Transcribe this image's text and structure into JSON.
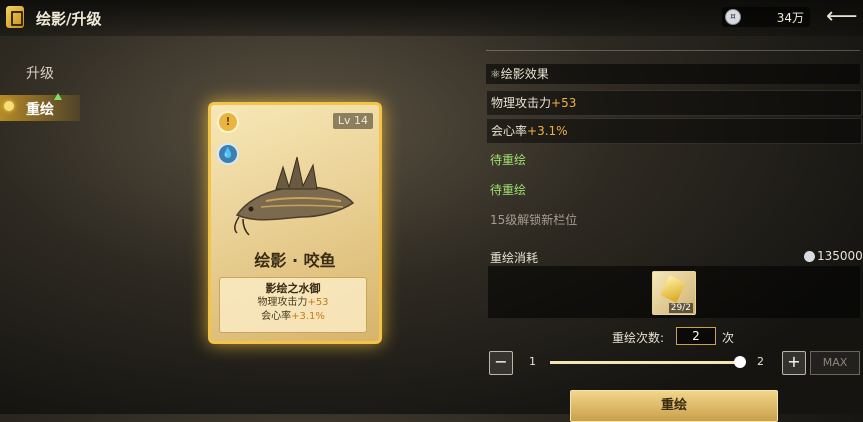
{
  "header": {
    "title": "绘影/升级",
    "currency_value": "34万"
  },
  "sidebar": {
    "items": [
      {
        "label": "升级",
        "selected": false
      },
      {
        "label": "重绘",
        "selected": true
      }
    ]
  },
  "card": {
    "level": "Lv 14",
    "name": "绘影 · 咬鱼",
    "skill_title": "影绘之水御",
    "stat1_name": "物理攻击力",
    "stat1_value": "+53",
    "stat2_name": "会心率",
    "stat2_value": "+3.1%"
  },
  "effects": {
    "header": "绘影效果",
    "rows": [
      {
        "name": "物理攻击力",
        "value": "+53"
      },
      {
        "name": "会心率",
        "value": "+3.1%"
      },
      {
        "text": "待重绘"
      },
      {
        "text": "待重绘"
      },
      {
        "text": "15级解锁新栏位"
      }
    ]
  },
  "cost": {
    "label": "重绘消耗",
    "value": "135000",
    "material_count": "29/2"
  },
  "count": {
    "label": "重绘次数:",
    "value": "2",
    "unit": "次",
    "slider_min": "1",
    "slider_max": "2",
    "slider_level": 1.0,
    "max_label": "MAX"
  },
  "action": {
    "redraw_label": "重绘"
  },
  "colors": {
    "accent": "#f0b040",
    "pending_green": "#9ee070",
    "card_glow": "#f3c447"
  }
}
